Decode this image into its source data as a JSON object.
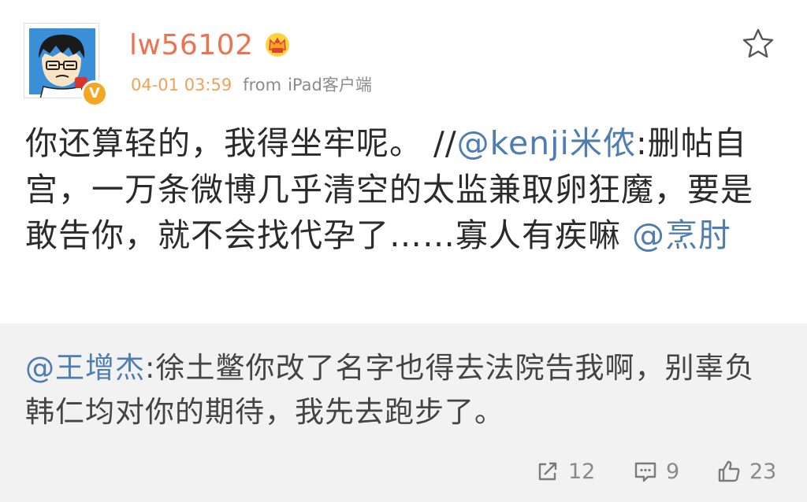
{
  "post": {
    "username": "lw56102",
    "time": "04-01 03:59",
    "from_label": "from",
    "source": "iPad客户端",
    "text_part1": "你还算轻的，我得坐牢呢。 //",
    "mention1": "@kenji米侬",
    "text_part2": ":删帖自宫，一万条微博几乎清空的太监兼取卵狂魔，要是敢告你，就不会找代孕了……寡人有疾嘛 ",
    "mention2": "@烹肘"
  },
  "repost": {
    "mention": "@王增杰",
    "text": ":徐土鳖你改了名字也得去法院告我啊，别辜负韩仁均对你的期待，我先去跑步了。"
  },
  "actions": {
    "repost_count": "12",
    "comment_count": "9",
    "like_count": "23"
  },
  "icons": {
    "favorite": "star-outline-icon",
    "vip": "crown-icon",
    "verified": "verified-v-icon",
    "repost": "share-arrow-icon",
    "comment": "comment-icon",
    "like": "thumbs-up-icon"
  },
  "colors": {
    "username": "#eb7350",
    "timestamp": "#f2a057",
    "mention": "#4f7db2",
    "body_text": "#2b2b2b",
    "repost_bg": "#f2f2f2",
    "verified_badge": "#f5a623"
  }
}
